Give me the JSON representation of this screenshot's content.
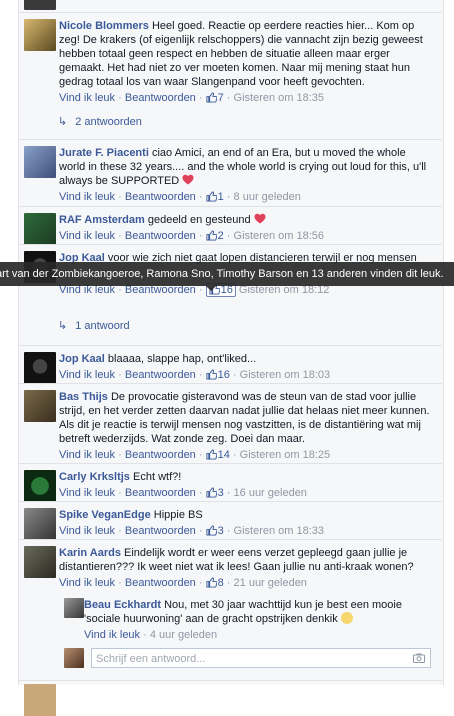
{
  "ui": {
    "like_label": "Vind ik leuk",
    "reply_label": "Beantwoorden",
    "sep": "·"
  },
  "comments": [
    {
      "name": "Nicole Blommers",
      "text": "Heel goed. Reactie op eerdere reacties hier... Kom op zeg! De krakers (of eigenlijk relschoppers) die vannacht zijn bezig geweest hebben totaal geen respect en hebben de situatie alleen maar erger gemaakt. Het had niet zo ver moeten komen. Naar mij mening staat hun gedrag totaal los van waar Slangenpand voor heeft gevochten.",
      "likes": "7",
      "time": "Gisteren om 18:35"
    },
    {
      "name": "Jurate F. Piacenti",
      "text": "ciao Amici, an end of an Era, but u moved the whole world in these 32 years.... and the whole world is crying out loud for this, u'll always be SUPPORTED",
      "likes": "1",
      "time": "8 uur geleden"
    },
    {
      "name": "RAF Amsterdam",
      "text": "gedeeld en gesteund",
      "likes": "2",
      "time": "Gisteren om 18:56"
    },
    {
      "name": "Jop Kaal",
      "text": "voor wie zich niet gaat lopen distancieren terwijl er nog mensen",
      "likes": "16",
      "time": "Gisteren om 18:12"
    },
    {
      "name": "Jop Kaal",
      "text": "blaaaa, slappe hap, ont'liked...",
      "likes": "16",
      "time": "Gisteren om 18:03"
    },
    {
      "name": "Bas Thijs",
      "text": "De provocatie gisteravond was de steun van de stad voor jullie strijd, en het verder zetten daarvan nadat jullie dat helaas niet meer kunnen. Als dit je reactie is terwijl mensen nog vastzitten, is de distantiëring wat mij betreft wederzijds. Wat zonde zeg. Doei dan maar.",
      "likes": "14",
      "time": "Gisteren om 18:25"
    },
    {
      "name": "Carly Krksltjs",
      "text": "Echt wtf?!",
      "likes": "3",
      "time": "16 uur geleden"
    },
    {
      "name": "Spike VeganEdge",
      "text": "Hippie BS",
      "likes": "3",
      "time": "Gisteren om 18:33"
    },
    {
      "name": "Karin Aards",
      "text": "Eindelijk wordt er weer eens verzet gepleegd gaan jullie je distantieren??? Ik weet niet wat ik lees! Gaan jullie nu anti-kraak wonen?",
      "likes": "8",
      "time": "21 uur geleden"
    }
  ],
  "reply": {
    "name": "Beau Eckhardt",
    "text": "Nou, met 30 jaar wachttijd kun je best een mooie 'sociale huurwoning' aan de gracht opstrijken denkik",
    "time": "4 uur geleden"
  },
  "replies_links": [
    "2 antwoorden",
    "1 antwoord"
  ],
  "tooltip": "art van der Zombiekangoeroe, Ramona Sno, Timothy Barson en 13 anderen vinden dit leuk.",
  "reply_input": {
    "placeholder": "Schrijf een antwoord..."
  },
  "colors": {
    "link": "#3b5998",
    "meta": "#9197a3",
    "heart": "#e0415a",
    "background": "#f6f7f9"
  }
}
